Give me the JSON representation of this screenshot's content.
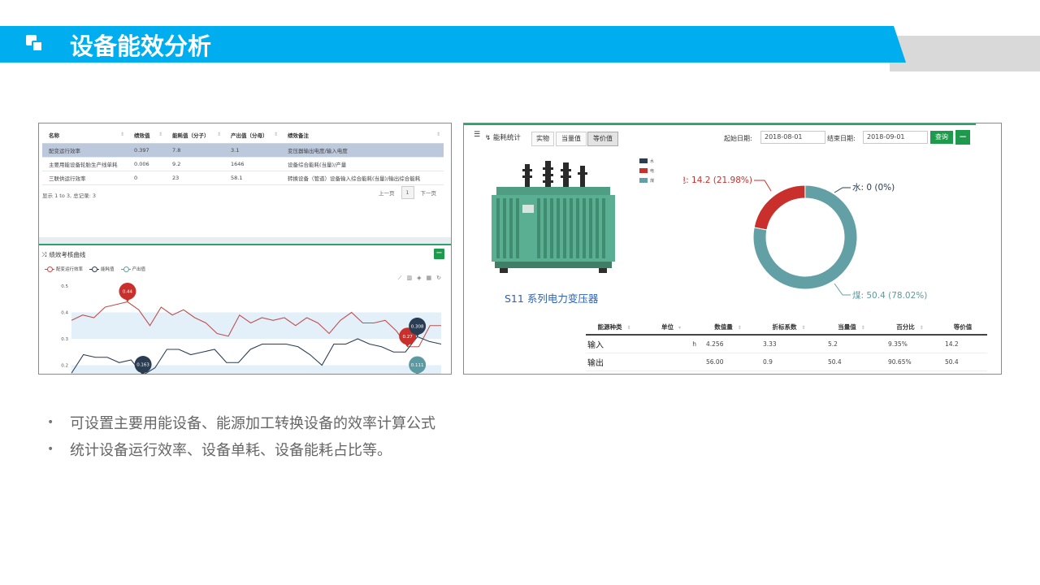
{
  "header": {
    "title": "设备能效分析"
  },
  "left_panel": {
    "table": {
      "columns": [
        "名称",
        "绩效值",
        "能耗值（分子）",
        "产出值（分母）",
        "绩效备注"
      ],
      "rows": [
        [
          "配变运行效率",
          "0.397",
          "7.8",
          "3.1",
          "变压器输出电度/输入电度"
        ],
        [
          "主要用能设备轮胎生产线单耗",
          "0.006",
          "9.2",
          "1646",
          "设备综合能耗(当量)/产量"
        ],
        [
          "三联供运行效率",
          "0",
          "23",
          "58.1",
          "转换设备（管道）设备输入综合能耗(当量)/输出综合能耗"
        ]
      ],
      "footer": "显示 1 to 3, 总记录: 3",
      "pager": {
        "prev": "上一页",
        "current": "1",
        "next": "下一页"
      }
    },
    "chart_panel": {
      "title": "绩效考核曲线",
      "collapse": "−",
      "legend": [
        "配变运行效率",
        "能耗值",
        "产出值"
      ]
    }
  },
  "chart_data": {
    "type": "line",
    "y_ticks": [
      "0.5",
      "0.4",
      "0.3",
      "0.2"
    ],
    "ylim": [
      0.17,
      0.5
    ],
    "series": [
      {
        "name": "配变运行效率",
        "color": "#c0504d",
        "values": [
          0.37,
          0.39,
          0.38,
          0.42,
          0.43,
          0.44,
          0.41,
          0.35,
          0.42,
          0.39,
          0.41,
          0.38,
          0.36,
          0.32,
          0.31,
          0.39,
          0.36,
          0.38,
          0.37,
          0.38,
          0.35,
          0.38,
          0.36,
          0.32,
          0.37,
          0.4,
          0.36,
          0.36,
          0.37,
          0.33,
          0.27,
          0.27,
          0.35,
          0.35
        ]
      },
      {
        "name": "能耗值",
        "color": "#2a3d52",
        "values": [
          0.17,
          0.24,
          0.23,
          0.23,
          0.21,
          0.22,
          0.163,
          0.19,
          0.26,
          0.26,
          0.24,
          0.25,
          0.26,
          0.21,
          0.21,
          0.26,
          0.28,
          0.28,
          0.28,
          0.27,
          0.24,
          0.2,
          0.28,
          0.28,
          0.3,
          0.28,
          0.27,
          0.25,
          0.25,
          0.308,
          0.29,
          0.28
        ]
      }
    ],
    "callouts": [
      {
        "label": "0.44",
        "series": 0,
        "index": 5,
        "color": "#c9302c"
      },
      {
        "label": "0.27",
        "series": 0,
        "index": 30,
        "color": "#c9302c"
      },
      {
        "label": "0.163",
        "series": 1,
        "index": 6,
        "color": "#2a3d52"
      },
      {
        "label": "0.308",
        "series": 1,
        "index": 29,
        "color": "#2a3d52"
      },
      {
        "label": "0.111",
        "series": 1,
        "index": 29,
        "color": "#5b9aa0"
      }
    ]
  },
  "right_panel": {
    "toolbar": {
      "title": "能耗统计",
      "tabs": [
        "实物",
        "当量值",
        "等价值"
      ],
      "start_label": "起始日期:",
      "start_date": "2018-08-01",
      "end_label": "结束日期:",
      "end_date": "2018-09-01",
      "query": "查询",
      "collapse": "−"
    },
    "image_caption": "S11 系列电力变压器",
    "pie": {
      "legend": [
        {
          "name": "水",
          "color": "#2a3d52"
        },
        {
          "name": "电",
          "color": "#c9302c"
        },
        {
          "name": "煤",
          "color": "#63a0a6"
        }
      ],
      "slices": [
        {
          "name": "水",
          "value": 0,
          "percent": "0%",
          "label": "水: 0 (0%)",
          "color": "#2a3d52"
        },
        {
          "name": "电",
          "value": 14.2,
          "percent": "21.98%",
          "label": "电: 14.2 (21.98%)",
          "color": "#c9302c"
        },
        {
          "name": "煤",
          "value": 50.4,
          "percent": "78.02%",
          "label": "煤: 50.4 (78.02%)",
          "color": "#63a0a6"
        }
      ]
    },
    "table": {
      "columns": [
        "能源种类",
        "单位",
        "数值量",
        "折标系数",
        "当量值",
        "百分比",
        "等价值"
      ],
      "rows": [
        [
          "输入",
          "h",
          "4.256",
          "3.33",
          "5.2",
          "9.35%",
          "14.2"
        ],
        [
          "输出",
          "",
          "56.00",
          "0.9",
          "50.4",
          "90.65%",
          "50.4"
        ]
      ]
    }
  },
  "bullets": [
    "可设置主要用能设备、能源加工转换设备的效率计算公式",
    "统计设备运行效率、设备单耗、设备能耗占比等。"
  ]
}
